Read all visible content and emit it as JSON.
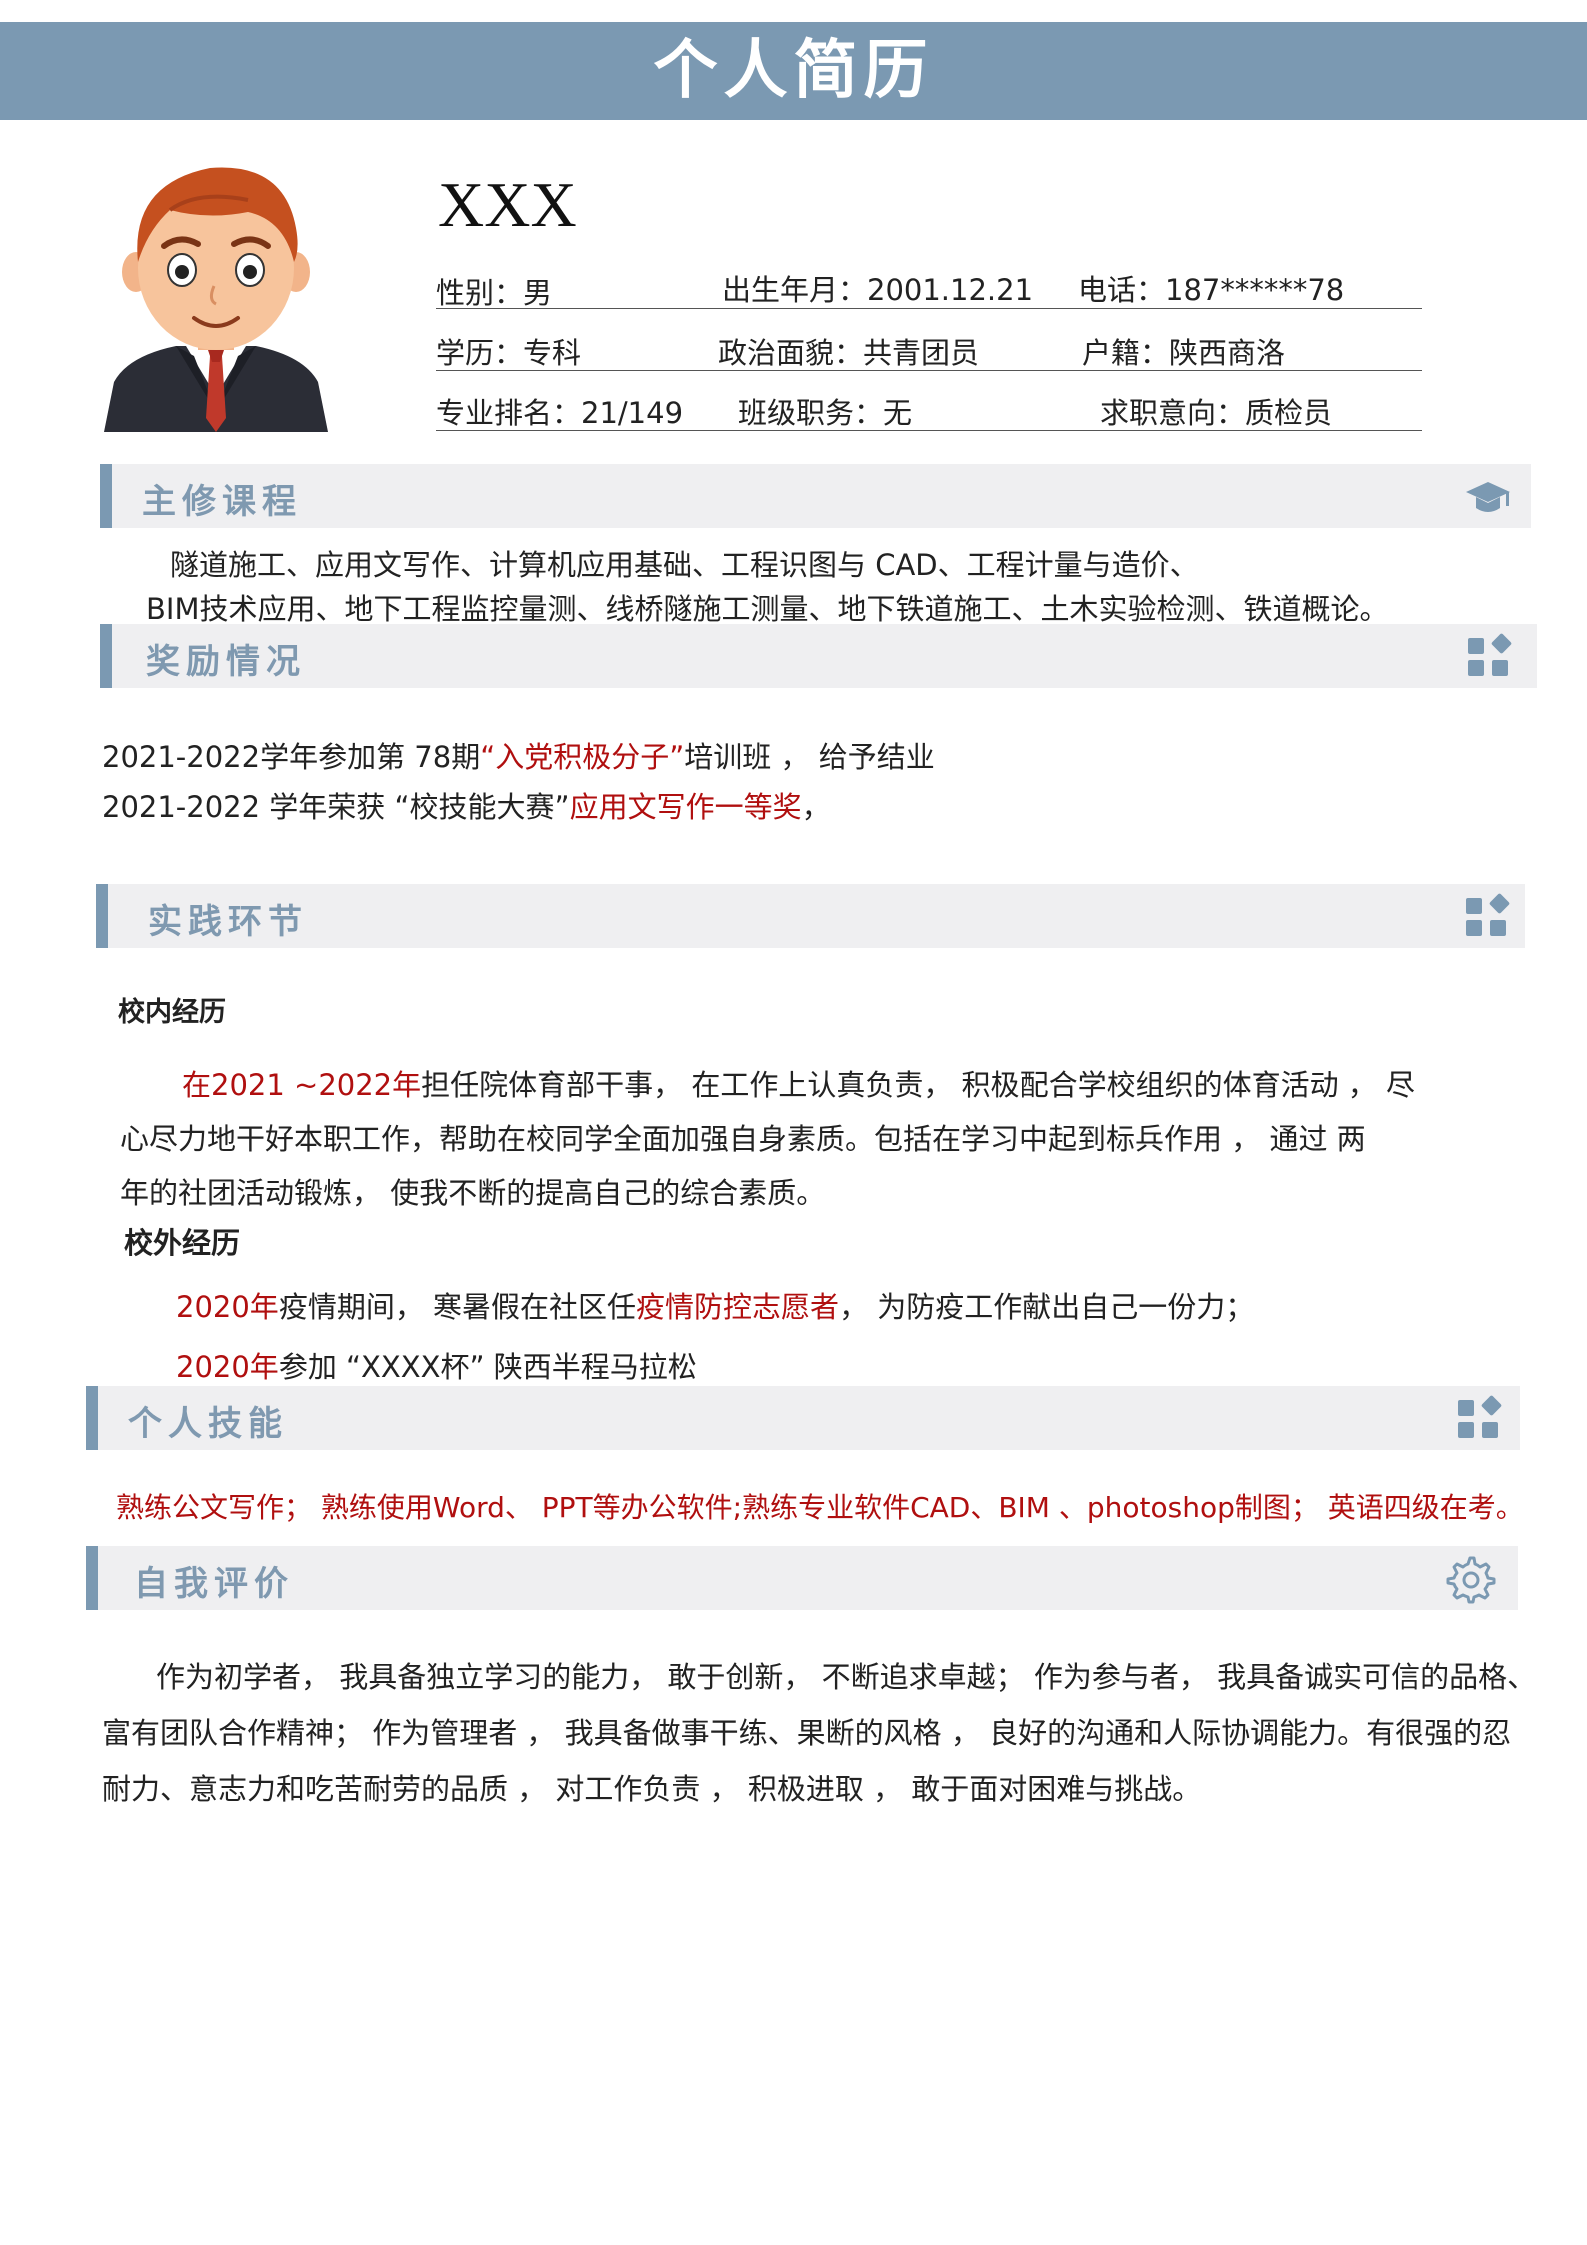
{
  "header": {
    "title": "个人简历"
  },
  "profile": {
    "name": "XXX",
    "gender": "性别：男",
    "birth": "出生年月：2001.12.21",
    "phone": "电话：187******78",
    "education": "学历：专科",
    "politics": "政治面貌：共青团员",
    "hukou": "户籍：陕西商洛",
    "rank": "专业排名：21/149",
    "duty": "班级职务：无",
    "intent": "求职意向：质检员"
  },
  "sections": {
    "courses": {
      "title": "主修课程",
      "icon": "graduation-cap-icon",
      "line1": "隧道施工、应用文写作、计算机应用基础、工程识图与 CAD、工程计量与造价、",
      "line2": "BIM技术应用、地下工程监控量测、线桥隧施工测量、地下铁道施工、土木实验检测、铁道概论。"
    },
    "awards": {
      "title": "奖励情况",
      "icon": "grid-icon",
      "a1_pre": "2021-2022学年参加第 78期",
      "a1_red": "“入党积极分子”",
      "a1_post": "培训班 ， 给予结业",
      "a2_pre": "2021-2022 学年荣获 “校技能大赛”",
      "a2_red": "应用文写作一等奖",
      "a2_post": "，"
    },
    "practice": {
      "title": "实践环节",
      "icon": "grid-icon",
      "inner_title": "校内经历",
      "inner_red": "在2021 ~2022年",
      "inner_l1": "担任院体育部干事， 在工作上认真负责， 积极配合学校组织的体育活动 ， 尽",
      "inner_l2": "心尽力地干好本职工作，帮助在校同学全面加强自身素质。包括在学习中起到标兵作用 ，  通过   两",
      "inner_l3": "年的社团活动锻炼， 使我不断的提高自己的综合素质。",
      "outer_title": "校外经历",
      "o1_red": "2020年",
      "o1_mid": "疫情期间， 寒暑假在社区任",
      "o1_red2": "疫情防控志愿者",
      "o1_post": "， 为防疫工作献出自己一份力；",
      "o2_red": "2020年",
      "o2_post": "参加 “XXXX杯” 陕西半程马拉松"
    },
    "skills": {
      "title": "个人技能",
      "icon": "grid-icon",
      "text": "熟练公文写作； 熟练使用Word、  PPT等办公软件;熟练专业软件CAD、BIM 、photoshop制图； 英语四级在考。"
    },
    "self": {
      "title": "自我评价",
      "icon": "gear-icon",
      "l1": "作为初学者， 我具备独立学习的能力， 敢于创新， 不断追求卓越； 作为参与者， 我具备诚实可信的品格、",
      "l2": "富有团队合作精神； 作为管理者 ， 我具备做事干练、果断的风格 ， 良好的沟通和人际协调能力。有很强的忍",
      "l3": "耐力、意志力和吃苦耐劳的品质 ， 对工作负责 ， 积极进取 ， 敢于面对困难与挑战。"
    }
  },
  "colors": {
    "accent": "#7b99b2",
    "section_bg": "#efeff1",
    "highlight": "#b00f0f"
  }
}
